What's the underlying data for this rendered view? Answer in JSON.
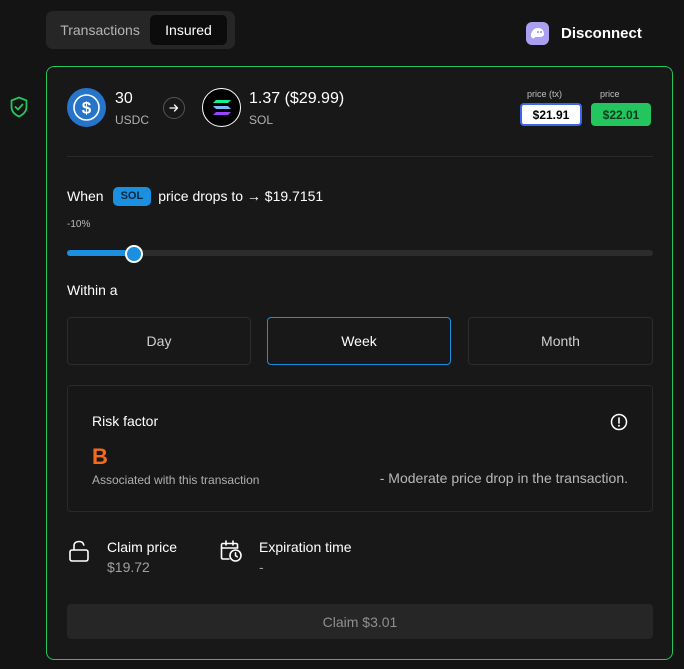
{
  "tabs": [
    {
      "label": "Transactions",
      "active": false
    },
    {
      "label": "Insured",
      "active": true
    }
  ],
  "header": {
    "disconnect_label": "Disconnect",
    "wallet_icon": "phantom-ghost-icon"
  },
  "swap": {
    "from": {
      "amount": "30",
      "symbol": "USDC",
      "icon": "usdc-icon"
    },
    "to": {
      "amount": "1.37 ($29.99)",
      "symbol": "SOL",
      "icon": "solana-icon"
    },
    "price_tx_label": "price (tx)",
    "price_tx_value": "$21.91",
    "price_label": "price",
    "price_value": "$22.01"
  },
  "trigger": {
    "when_label": "When",
    "token_badge": "SOL",
    "drop_text": "price drops to → $19.7151",
    "percent": "-10%",
    "slider_fraction": 0.115
  },
  "period": {
    "within_label": "Within a",
    "options": [
      "Day",
      "Week",
      "Month"
    ],
    "selected": "Week"
  },
  "risk": {
    "title": "Risk factor",
    "grade": "B",
    "associated": "Associated with this transaction",
    "description": "- Moderate price drop in the transaction."
  },
  "claim": {
    "price_label": "Claim price",
    "price_value": "$19.72",
    "expiration_label": "Expiration time",
    "expiration_value": "-",
    "button_label": "Claim $3.01"
  },
  "colors": {
    "accent_green": "#22c55e",
    "accent_blue": "#1b8fe0",
    "risk_orange": "#f26b1d",
    "background": "#141414"
  }
}
